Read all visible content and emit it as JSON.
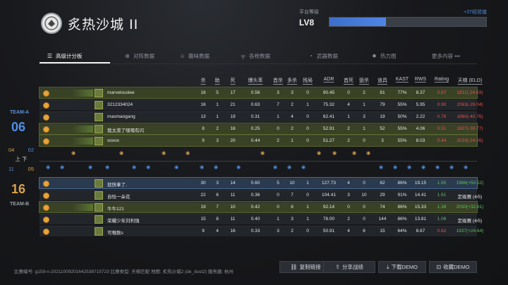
{
  "header": {
    "map_title": "炙热沙城 II",
    "level_label": "平台等级",
    "level_value": "LV8",
    "level_progress": 0.36,
    "level_gain": "+37经验值"
  },
  "tabs": [
    {
      "label": "高级计分板",
      "icon": "list-icon",
      "active": true
    },
    {
      "label": "对阵数据",
      "icon": "versus-icon"
    },
    {
      "label": "趣味数据",
      "icon": "smile-icon"
    },
    {
      "label": "各枪数据",
      "icon": "rifle-icon"
    },
    {
      "label": "武器数据",
      "icon": "clock-icon"
    },
    {
      "label": "热力图",
      "icon": "heat-icon"
    },
    {
      "label": "更多内容 •••",
      "icon": ""
    }
  ],
  "columns": [
    "杀",
    "助",
    "死",
    "爆头率",
    "首杀",
    "多杀",
    "残局",
    "ADR",
    "首死",
    "狙杀",
    "道具",
    "KAST",
    "RWS",
    "Rating",
    "天梯 (ELO)"
  ],
  "team_a": {
    "label": "TEAM-A",
    "score": "06",
    "players": [
      {
        "name": "marvelouslee",
        "k": "16",
        "a": "5",
        "d": "17",
        "hs": "0.56",
        "fk": "3",
        "mk": "3",
        "clutch": "0",
        "adr": "90.45",
        "fd": "0",
        "snipe": "2",
        "util": "81",
        "kast": "77%",
        "rws": "8.37",
        "rating": "0.87",
        "elo": "1811(-24.03)"
      },
      {
        "name": "3212334024",
        "k": "16",
        "a": "1",
        "d": "21",
        "hs": "0.63",
        "fk": "7",
        "mk": "2",
        "clutch": "1",
        "adr": "75.32",
        "fd": "4",
        "snipe": "1",
        "util": "79",
        "kast": "55%",
        "rws": "5.95",
        "rating": "0.90",
        "elo": "2063(-29.04)"
      },
      {
        "name": "maomaogang",
        "k": "13",
        "a": "1",
        "d": "19",
        "hs": "0.31",
        "fk": "1",
        "mk": "4",
        "clutch": "0",
        "adr": "62.41",
        "fd": "1",
        "snipe": "3",
        "util": "19",
        "kast": "50%",
        "rws": "2.22",
        "rating": "0.76",
        "elo": "1860(-40.76)"
      },
      {
        "name": "我太菜了嘿嘿有闪",
        "k": "8",
        "a": "2",
        "d": "18",
        "hs": "0.25",
        "fk": "0",
        "mk": "2",
        "clutch": "0",
        "adr": "52.91",
        "fd": "2",
        "snipe": "1",
        "util": "52",
        "kast": "55%",
        "rws": "4.06",
        "rating": "0.51",
        "elo": "1827(-39.77)"
      },
      {
        "name": "xoxox",
        "k": "9",
        "a": "3",
        "d": "20",
        "hs": "0.44",
        "fk": "2",
        "mk": "1",
        "clutch": "0",
        "adr": "51.27",
        "fd": "2",
        "snipe": "0",
        "util": "3",
        "kast": "55%",
        "rws": "8.03",
        "rating": "0.44",
        "elo": "2019(-24.26)"
      }
    ]
  },
  "halves": [
    {
      "a": "04",
      "m": "",
      "b": "02"
    },
    {
      "a": "",
      "m": "上  下",
      "b": ""
    },
    {
      "a": "11",
      "m": "",
      "b": "05"
    }
  ],
  "team_b": {
    "label": "TEAM-B",
    "score": "16",
    "players": [
      {
        "name": "就快拿了.",
        "k": "30",
        "a": "3",
        "d": "14",
        "hs": "0.60",
        "fk": "5",
        "mk": "10",
        "clutch": "1",
        "adr": "127.73",
        "fd": "4",
        "snipe": "0",
        "util": "62",
        "kast": "86%",
        "rws": "19.15",
        "rating": "1.95",
        "elo": "1986(+50.52)"
      },
      {
        "name": "自恰一朵花",
        "k": "22",
        "a": "6",
        "d": "11",
        "hs": "0.36",
        "fk": "0",
        "mk": "7",
        "clutch": "0",
        "adr": "104.41",
        "fd": "3",
        "snipe": "10",
        "util": "29",
        "kast": "91%",
        "rws": "14.41",
        "rating": "1.61",
        "elo": "定级赛 (4/5)"
      },
      {
        "name": "牛牛121",
        "k": "19",
        "a": "7",
        "d": "10",
        "hs": "0.42",
        "fk": "0",
        "mk": "6",
        "clutch": "1",
        "adr": "92.14",
        "fd": "0",
        "snipe": "0",
        "util": "74",
        "kast": "86%",
        "rws": "15.33",
        "rating": "1.38",
        "elo": "2030(+32.81)"
      },
      {
        "name": "荣耀少年刘利强",
        "k": "15",
        "a": "8",
        "d": "11",
        "hs": "0.40",
        "fk": "1",
        "mk": "3",
        "clutch": "1",
        "adr": "78.00",
        "fd": "2",
        "snipe": "0",
        "util": "144",
        "kast": "86%",
        "rws": "13.81",
        "rating": "1.06",
        "elo": "定级赛 (4/5)"
      },
      {
        "name": "可嗷数s",
        "k": "9",
        "a": "4",
        "d": "16",
        "hs": "0.33",
        "fk": "3",
        "mk": "2",
        "clutch": "0",
        "adr": "50.91",
        "fd": "4",
        "snipe": "6",
        "util": "15",
        "kast": "64%",
        "rws": "8.67",
        "rating": "0.62",
        "elo": "1937(+24.64)"
      }
    ]
  },
  "footer": {
    "match_info": "比赛编号: g159-n-20211009201642538715723  比赛类型: 天梯匹配  地图: 炙热沙城2 (de_dust2)  服务器: 杭州",
    "buttons": [
      {
        "label": "复制链接",
        "icon": "link-icon"
      },
      {
        "label": "分享战绩",
        "icon": "share-icon"
      },
      {
        "label": "下载DEMO",
        "icon": "download-icon"
      },
      {
        "label": "收藏DEMO",
        "icon": "bookmark-icon"
      }
    ]
  },
  "colors": {
    "accent_blue": "#4f8fe6",
    "accent_gold": "#d9a24e",
    "negative": "#e4524a",
    "positive": "#5bc25b"
  }
}
